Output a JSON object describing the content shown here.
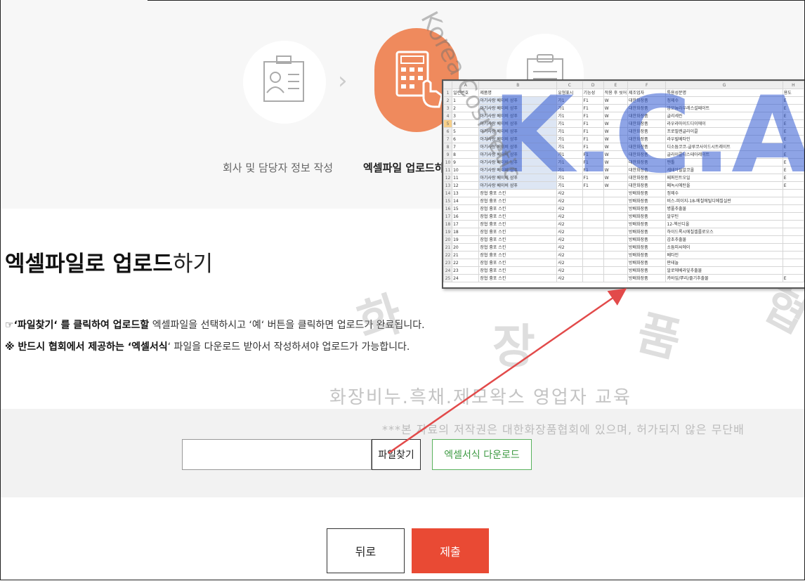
{
  "steps": [
    {
      "label": "회사 및 담당자 정보 작성",
      "icon": "id-card-icon"
    },
    {
      "label": "엑셀파일 업로드하",
      "icon": "calculator-hand-icon"
    },
    {
      "label": "",
      "icon": "clipboard-icon"
    }
  ],
  "page": {
    "title_bold": "엑셀파일로 업로드",
    "title_light": "하기",
    "desc1_icon": "☞",
    "desc1_strong1": "‘파일찾기‘ 를 클릭하여 업로드할",
    "desc1_rest": " 엑셀파일을 선택하시고 ‘예‘ 버튼을 클릭하면 업로드가 완료됩니다.",
    "desc2_strong": "※ 반드시 협회에서 제공하는 ‘엑셀서식",
    "desc2_rest": "‘ 파일을 다운로드 받아서 작성하셔야 업로드가 가능합니다."
  },
  "watermark": {
    "line": "화장비누.흑채.제모왁스 영업자 교육",
    "copyright": "***본 자료의 저작권은 대한화장품협회에 있으며, 허가되지 않은 무단배",
    "big_chars": [
      "화",
      "장",
      "품",
      "협"
    ],
    "overlay": "K.C.A",
    "diag": "Korea Cosmetic"
  },
  "upload": {
    "file_value": "",
    "find_button": "파일찾기",
    "download_button": "엑셀서식 다운로드"
  },
  "actions": {
    "back": "뒤로",
    "submit": "제출"
  },
  "colors": {
    "accent_orange": "#ef8a5d",
    "submit_red": "#e94a34",
    "download_green": "#3e9a43",
    "arrow_red": "#e24a4a"
  },
  "sheet": {
    "columns": [
      "",
      "A",
      "B",
      "C",
      "D",
      "E",
      "F",
      "G",
      "H"
    ],
    "header": [
      "1",
      "일련번호",
      "제품명",
      "유형표시",
      "기능성",
      "작용 후 씻어",
      "제조업자",
      "특용성분명",
      "용도"
    ],
    "rows": [
      [
        "2",
        "1",
        "아기사랑 베이비 샴푸",
        "가1",
        "F1",
        "W",
        "대한화장품",
        "정제수",
        "E"
      ],
      [
        "3",
        "2",
        "아기사랑 베이비 샴푸",
        "가1",
        "F1",
        "W",
        "대한화장품",
        "암모늄라우레스설페이트",
        "E"
      ],
      [
        "4",
        "3",
        "아기사랑 베이비 샴푸",
        "가1",
        "F1",
        "W",
        "대한화장품",
        "글리세린",
        "E"
      ],
      [
        "5",
        "4",
        "아기사랑 베이비 샴푸",
        "가1",
        "F1",
        "W",
        "대한화장품",
        "라우라마이드디이에이",
        "E"
      ],
      [
        "6",
        "5",
        "아기사랑 베이비 샴푸",
        "가1",
        "F1",
        "W",
        "대한화장품",
        "프로필렌글라이콜",
        "E"
      ],
      [
        "7",
        "6",
        "아기사랑 베이비 샴푸",
        "가1",
        "F1",
        "W",
        "대한화장품",
        "라우릴베타인",
        "E"
      ],
      [
        "8",
        "7",
        "아기사랑 베이비 샴푸",
        "가1",
        "F1",
        "W",
        "대한화장품",
        "디소듐코코-글루코사이드시트레이트",
        "E"
      ],
      [
        "9",
        "8",
        "아기사랑 베이비 샴푸",
        "가1",
        "F1",
        "W",
        "대한화장품",
        "글라이콜디스테아레이트",
        "E"
      ],
      [
        "10",
        "9",
        "아기사랑 베이비 샴푸",
        "가1",
        "F1",
        "W",
        "대한화장품",
        "멘톨",
        "E"
      ],
      [
        "11",
        "10",
        "아기사랑 베이비 샴푸",
        "가1",
        "F1",
        "W",
        "대한화장품",
        "세테아릴알코올",
        "E"
      ],
      [
        "12",
        "11",
        "아기사랑 베이비 샴푸",
        "가1",
        "F1",
        "W",
        "대한화장품",
        "페퍼민트오일",
        "E"
      ],
      [
        "13",
        "12",
        "아기사랑 베이비 샴푸",
        "가1",
        "F1",
        "W",
        "대한화장품",
        "폐녹시에탄올",
        "E"
      ],
      [
        "14",
        "13",
        "장협 흉포 스킨",
        "사2",
        "",
        "",
        "방배화장품",
        "정제수",
        ""
      ],
      [
        "15",
        "14",
        "장협 흉포 스킨",
        "사2",
        "",
        "",
        "방배화장품",
        "비스-피이지-18-메칠에틸디메칠실란",
        ""
      ],
      [
        "16",
        "15",
        "장협 흉포 스킨",
        "사2",
        "",
        "",
        "방배화장품",
        "병풀추출물",
        ""
      ],
      [
        "17",
        "16",
        "장협 흉포 스킨",
        "사2",
        "",
        "",
        "방배화장품",
        "알부틴",
        ""
      ],
      [
        "18",
        "17",
        "장협 흉포 스킨",
        "사2",
        "",
        "",
        "방배화장품",
        "12-헥산디올",
        ""
      ],
      [
        "19",
        "18",
        "장협 흉포 스킨",
        "사2",
        "",
        "",
        "방배화장품",
        "하이드록시에칠셀룰로오스",
        ""
      ],
      [
        "20",
        "19",
        "장협 흉포 스킨",
        "사2",
        "",
        "",
        "방배화장품",
        "감초추출물",
        ""
      ],
      [
        "21",
        "20",
        "장협 흉포 스킨",
        "사2",
        "",
        "",
        "방배화장품",
        "소듐피씨에이",
        ""
      ],
      [
        "22",
        "21",
        "장협 흉포 스킨",
        "사2",
        "",
        "",
        "방배화장품",
        "베타인",
        ""
      ],
      [
        "23",
        "22",
        "장협 흉포 스킨",
        "사2",
        "",
        "",
        "방배화장품",
        "판테놀",
        ""
      ],
      [
        "24",
        "23",
        "장협 흉포 스킨",
        "사2",
        "",
        "",
        "방배화장품",
        "알로에베라잎추출물",
        ""
      ],
      [
        "25",
        "24",
        "장협 흉포 스킨",
        "사2",
        "",
        "",
        "방배화장품",
        "카바잎/뿌리/줄기추출물",
        "E"
      ]
    ]
  }
}
